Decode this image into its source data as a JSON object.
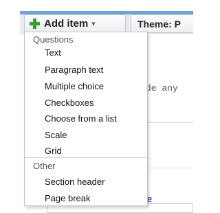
{
  "toolbar": {
    "add_item_label": "Add item",
    "caret": "▾",
    "theme_label": "Theme:  P"
  },
  "background": {
    "code_fragment": "de any",
    "link_fragment": "e"
  },
  "menu": {
    "sections": [
      {
        "header": "Questions",
        "items": [
          "Text",
          "Paragraph text",
          "Multiple choice",
          "Checkboxes",
          "Choose from a list",
          "Scale",
          "Grid"
        ]
      },
      {
        "header": "Other",
        "items": [
          "Section header",
          "Page break"
        ]
      }
    ]
  }
}
